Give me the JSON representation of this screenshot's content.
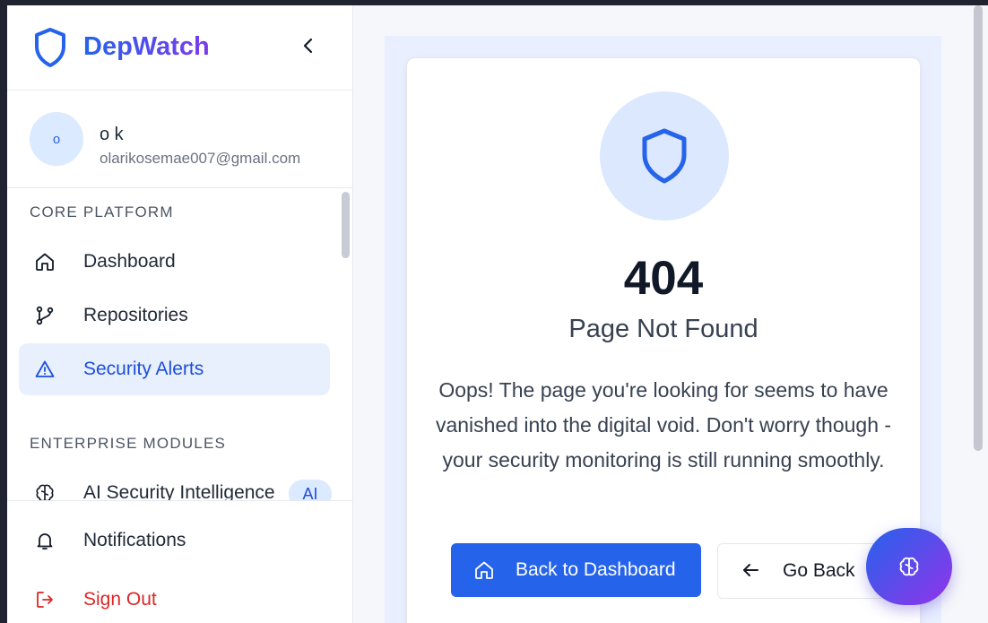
{
  "app": {
    "name": "DepWatch"
  },
  "user": {
    "initial": "o",
    "name": "o k",
    "email": "olarikosemae007@gmail.com"
  },
  "sidebar": {
    "sections": [
      {
        "title": "CORE PLATFORM",
        "items": [
          {
            "label": "Dashboard",
            "icon": "home-icon"
          },
          {
            "label": "Repositories",
            "icon": "git-branch-icon"
          },
          {
            "label": "Security Alerts",
            "icon": "alert-triangle-icon",
            "active": true
          }
        ]
      },
      {
        "title": "ENTERPRISE MODULES",
        "items": [
          {
            "label": "AI Security Intelligence",
            "icon": "brain-icon",
            "badge": "AI"
          }
        ]
      }
    ],
    "footer": [
      {
        "label": "Notifications",
        "icon": "bell-icon"
      },
      {
        "label": "Sign Out",
        "icon": "logout-icon"
      }
    ]
  },
  "error": {
    "code": "404",
    "title": "Page Not Found",
    "message": "Oops! The page you're looking for seems to have vanished into the digital void. Don't worry though - your security monitoring is still running smoothly.",
    "primary_button": "Back to Dashboard",
    "secondary_button": "Go Back"
  },
  "colors": {
    "accent": "#2563eb",
    "active_bg": "#e8f0fe",
    "danger": "#dc2626",
    "gradient_end": "#9333ea"
  }
}
